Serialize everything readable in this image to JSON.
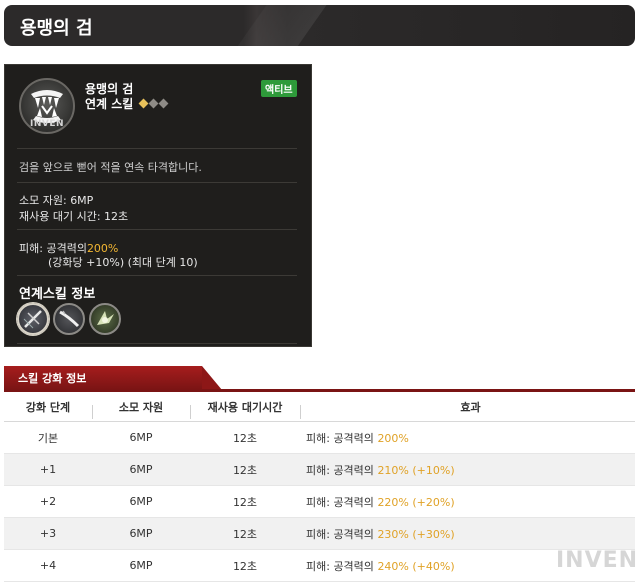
{
  "page_title": "용맹의 검",
  "tooltip": {
    "icon_name": "fang-skill-icon",
    "icon_watermark": "INVEN",
    "name": "용맹의 검",
    "sub": "연계 스킬",
    "badge": "액티브",
    "description": "검을 앞으로 뻗어 적을 연속 타격합니다.",
    "cost_label": "소모 자원:",
    "cost_value": "6MP",
    "cooldown_label": "재사용 대기 시간:",
    "cooldown_value": "12초",
    "damage_label": "피해:",
    "damage_prefix": "공격력의",
    "damage_value": "200%",
    "damage_note": "(강화당 +10%) (최대 단계 10)",
    "linked_title": "연계스킬 정보",
    "linked_icons": [
      "linked-skill-1-icon",
      "linked-skill-2-icon",
      "linked-skill-3-icon"
    ]
  },
  "section": {
    "tab_label": "스킬 강화 정보"
  },
  "table": {
    "headers": [
      "강화 단계",
      "소모 자원",
      "재사용 대기시간",
      "효과"
    ],
    "rows": [
      {
        "level": "기본",
        "cost": "6MP",
        "cooldown": "12초",
        "effect_prefix": "피해: 공격력의",
        "effect_value": "200%",
        "effect_bonus": ""
      },
      {
        "level": "+1",
        "cost": "6MP",
        "cooldown": "12초",
        "effect_prefix": "피해: 공격력의",
        "effect_value": "210%",
        "effect_bonus": "(+10%)"
      },
      {
        "level": "+2",
        "cost": "6MP",
        "cooldown": "12초",
        "effect_prefix": "피해: 공격력의",
        "effect_value": "220%",
        "effect_bonus": "(+20%)"
      },
      {
        "level": "+3",
        "cost": "6MP",
        "cooldown": "12초",
        "effect_prefix": "피해: 공격력의",
        "effect_value": "230%",
        "effect_bonus": "(+30%)"
      },
      {
        "level": "+4",
        "cost": "6MP",
        "cooldown": "12초",
        "effect_prefix": "피해: 공격력의",
        "effect_value": "240%",
        "effect_bonus": "(+40%)"
      }
    ]
  },
  "watermark": "INVEN",
  "colors": {
    "accent_red": "#8d1717",
    "highlight_gold": "#f2b632",
    "badge_green": "#2e9a3a"
  }
}
